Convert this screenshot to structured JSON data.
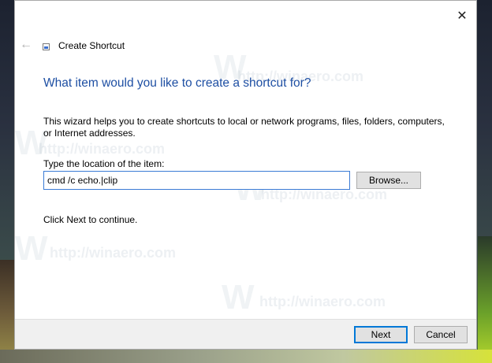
{
  "window": {
    "title": "Create Shortcut",
    "close_glyph": "✕",
    "back_glyph": "←",
    "icons": {
      "close": "close-icon",
      "back": "back-arrow-icon",
      "wizard": "shortcut-wizard-icon"
    }
  },
  "wizard": {
    "heading": "What item would you like to create a shortcut for?",
    "description": "This wizard helps you to create shortcuts to local or network programs, files, folders, computers, or Internet addresses.",
    "location_label": "Type the location of the item:",
    "location_value": "cmd /c echo.|clip",
    "browse_label": "Browse...",
    "continue_text": "Click Next to continue."
  },
  "footer": {
    "next_label": "Next",
    "cancel_label": "Cancel"
  },
  "watermark": {
    "text": "http://winaero.com",
    "letter": "W"
  },
  "colors": {
    "heading": "#1e4fa3",
    "input_border": "#3a7bd5",
    "default_button_border": "#0078d7",
    "footer_bg": "#f0f0f0"
  }
}
